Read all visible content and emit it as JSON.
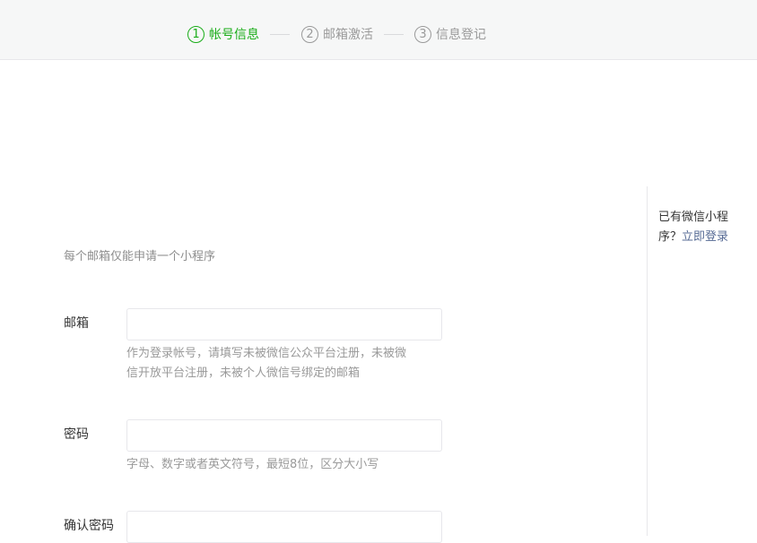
{
  "steps": [
    {
      "num": "1",
      "label": "帐号信息",
      "active": true
    },
    {
      "num": "2",
      "label": "邮箱激活",
      "active": false
    },
    {
      "num": "3",
      "label": "信息登记",
      "active": false
    }
  ],
  "form": {
    "tip": "每个邮箱仅能申请一个小程序",
    "email": {
      "label": "邮箱",
      "value": "",
      "hint": "作为登录帐号，请填写未被微信公众平台注册，未被微信开放平台注册，未被个人微信号绑定的邮箱"
    },
    "password": {
      "label": "密码",
      "value": "",
      "hint": "字母、数字或者英文符号，最短8位，区分大小写"
    },
    "confirm_password": {
      "label": "确认密码",
      "value": ""
    }
  },
  "sidebar": {
    "prompt": "已有微信小程序？",
    "login_link": "立即登录"
  },
  "colors": {
    "active_step": "#1aad19",
    "inactive_step": "#9a9a9a",
    "link": "#576b95",
    "topbar_bg": "#f6f7f7"
  }
}
